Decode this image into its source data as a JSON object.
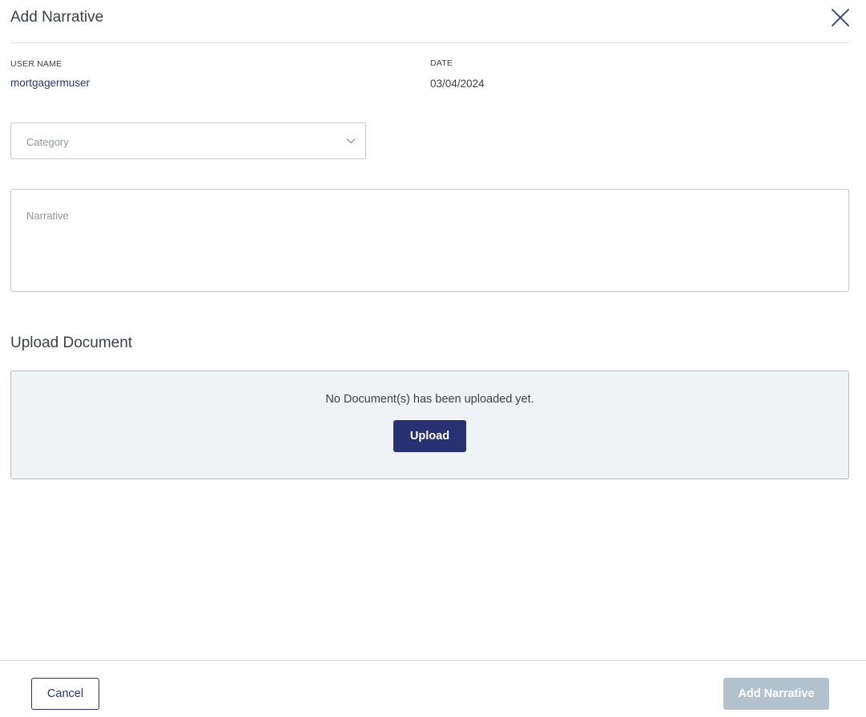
{
  "dialog": {
    "title": "Add Narrative",
    "close_icon": "close-icon"
  },
  "meta": {
    "user_name_label": "USER NAME",
    "user_name_value": "mortgagermuser",
    "date_label": "DATE",
    "date_value": "03/04/2024"
  },
  "form": {
    "category": {
      "placeholder": "Category",
      "selected_value": "",
      "icon": "chevron-down-icon"
    },
    "narrative": {
      "placeholder": "Narrative",
      "value": ""
    }
  },
  "upload": {
    "section_title": "Upload Document",
    "empty_message": "No Document(s) has been uploaded yet.",
    "upload_label": "Upload"
  },
  "footer": {
    "cancel_label": "Cancel",
    "submit_label": "Add Narrative",
    "submit_disabled": true
  },
  "colors": {
    "primary": "#283272",
    "link_text": "#2a3570",
    "disabled_button": "#b3c1cd",
    "upload_panel_bg": "#f0f3f6"
  }
}
